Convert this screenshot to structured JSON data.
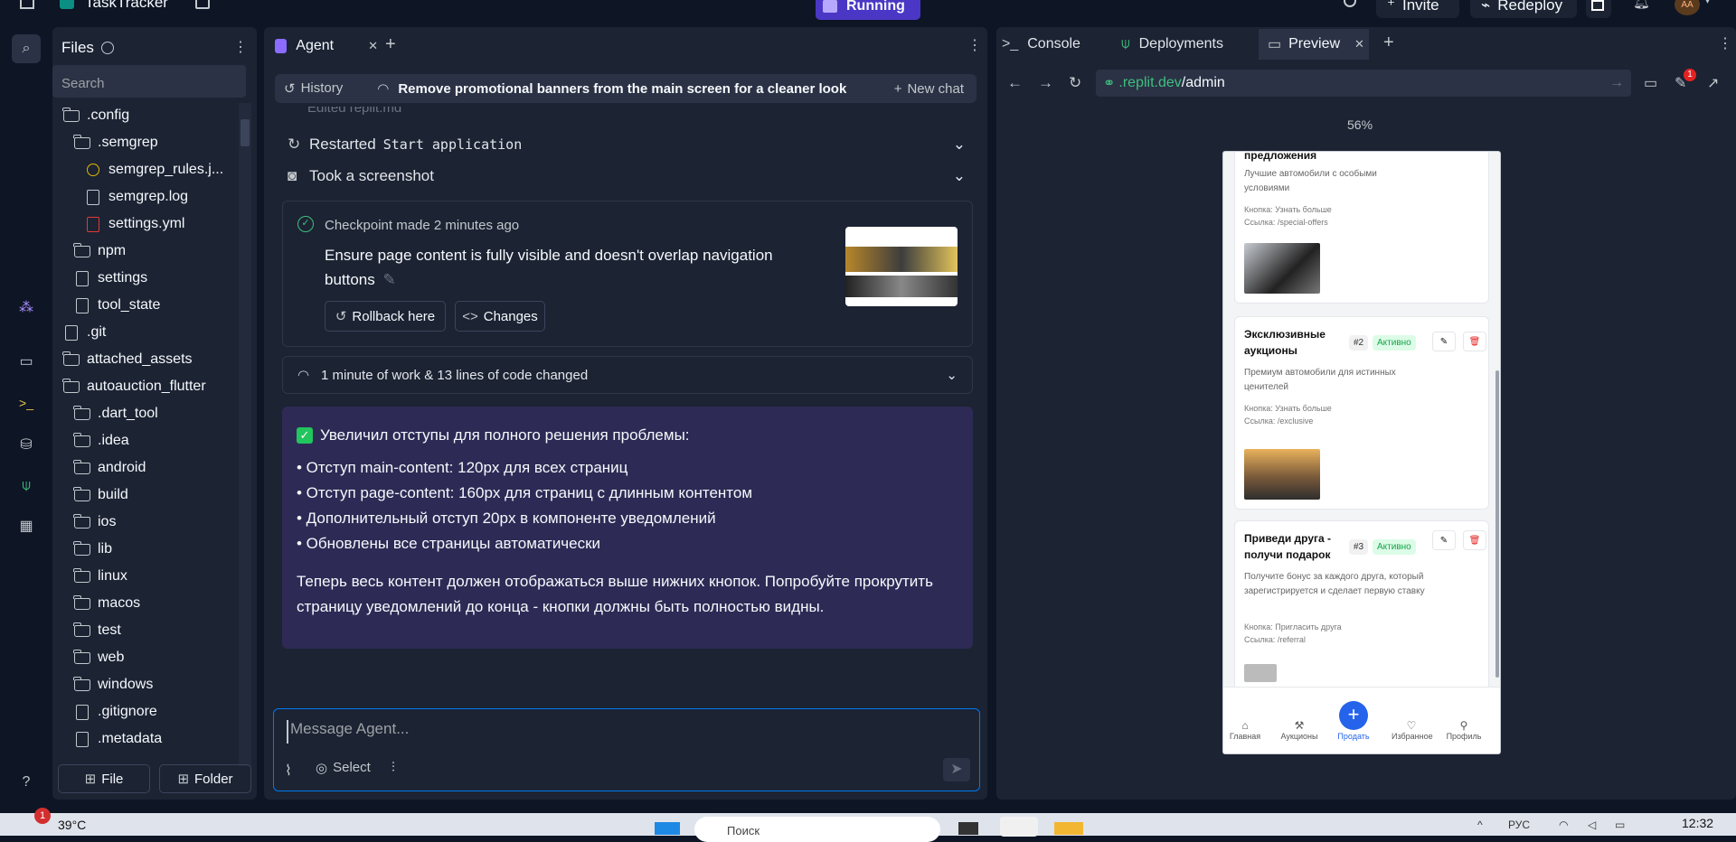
{
  "topbar": {
    "app_name": "TaskTracker",
    "status": "Running",
    "invite": "Invite",
    "redeploy": "Redeploy",
    "avatar": "AA"
  },
  "files_panel": {
    "title": "Files",
    "search_placeholder": "Search",
    "file_btn": "File",
    "folder_btn": "Folder",
    "items": [
      {
        "name": ".config",
        "type": "folder",
        "depth": 0
      },
      {
        "name": ".semgrep",
        "type": "folder",
        "depth": 1
      },
      {
        "name": "semgrep_rules.j...",
        "type": "file",
        "depth": 2
      },
      {
        "name": "semgrep.log",
        "type": "file",
        "depth": 2
      },
      {
        "name": "settings.yml",
        "type": "file",
        "depth": 2
      },
      {
        "name": "npm",
        "type": "folder",
        "depth": 1
      },
      {
        "name": "settings",
        "type": "file",
        "depth": 1
      },
      {
        "name": "tool_state",
        "type": "file",
        "depth": 1
      },
      {
        "name": ".git",
        "type": "file",
        "depth": 0
      },
      {
        "name": "attached_assets",
        "type": "folder",
        "depth": 0
      },
      {
        "name": "autoauction_flutter",
        "type": "folder",
        "depth": 0
      },
      {
        "name": ".dart_tool",
        "type": "folder",
        "depth": 1
      },
      {
        "name": ".idea",
        "type": "folder",
        "depth": 1
      },
      {
        "name": "android",
        "type": "folder",
        "depth": 1
      },
      {
        "name": "build",
        "type": "folder",
        "depth": 1
      },
      {
        "name": "ios",
        "type": "folder",
        "depth": 1
      },
      {
        "name": "lib",
        "type": "folder",
        "depth": 1
      },
      {
        "name": "linux",
        "type": "folder",
        "depth": 1
      },
      {
        "name": "macos",
        "type": "folder",
        "depth": 1
      },
      {
        "name": "test",
        "type": "folder",
        "depth": 1
      },
      {
        "name": "web",
        "type": "folder",
        "depth": 1
      },
      {
        "name": "windows",
        "type": "folder",
        "depth": 1
      },
      {
        "name": ".gitignore",
        "type": "file",
        "depth": 1
      },
      {
        "name": ".metadata",
        "type": "file",
        "depth": 1
      }
    ]
  },
  "agent": {
    "tab": "Agent",
    "history": "History",
    "chat_title": "Remove promotional banners from the main screen for a cleaner look",
    "new_chat": "New chat",
    "step_cut": "Edited replit.md",
    "step1_prefix": "Restarted",
    "step1_code": "Start application",
    "step2": "Took a screenshot",
    "checkpoint_prefix": "Checkpoint made",
    "checkpoint_time": "2 minutes ago",
    "checkpoint_text": "Ensure page content is fully visible and doesn't overlap navigation buttons",
    "rollback": "Rollback here",
    "changes": "Changes",
    "work_summary": "1 minute of work & 13 lines of code changed",
    "msg_title": "Увеличил отступы для полного решения проблемы:",
    "bullets": [
      "• Отступ main-content: 120px для всех страниц",
      "• Отступ page-content: 160px для страниц с длинным контентом",
      "• Дополнительный отступ 20px в компоненте уведомлений",
      "• Обновлены все страницы автоматически"
    ],
    "msg_footer": "Теперь весь контент должен отображаться выше нижних кнопок. Попробуйте прокрутить страницу уведомлений до конца - кнопки должны быть полностью видны.",
    "input_placeholder": "Message Agent...",
    "select": "Select"
  },
  "right": {
    "tabs": [
      "Console",
      "Deployments",
      "Preview"
    ],
    "url_host": ".replit.dev",
    "url_path": "/admin",
    "zoom": "56%",
    "notif_count": "1"
  },
  "preview": {
    "card0": {
      "title": "предложения",
      "desc": "Лучшие автомобили с особыми условиями",
      "button": "Кнопка: Узнать больше",
      "link": "Ссылка: /special-offers"
    },
    "card1": {
      "title": "Эксклюзивные аукционы",
      "num": "#2",
      "status": "Активно",
      "desc": "Премиум автомобили для истинных ценителей",
      "button": "Кнопка: Узнать больше",
      "link": "Ссылка: /exclusive"
    },
    "card2": {
      "title": "Приведи друга - получи подарок",
      "num": "#3",
      "status": "Активно",
      "desc": "Получите бонус за каждого друга, который зарегистрируется и сделает первую ставку",
      "button": "Кнопка: Пригласить друга",
      "link": "Ссылка: /referral"
    },
    "nav": [
      "Главная",
      "Аукционы",
      "Продать",
      "Избранное",
      "Профиль"
    ]
  },
  "taskbar": {
    "weather": "39°C",
    "weather_badge": "1",
    "search": "Поиск",
    "lang": "РУС",
    "time": "12:32"
  },
  "colors": {
    "accent": "#0079f2",
    "purple_msg": "#2b2a4e",
    "running": "#6a4cf0",
    "green": "#22c55e"
  }
}
